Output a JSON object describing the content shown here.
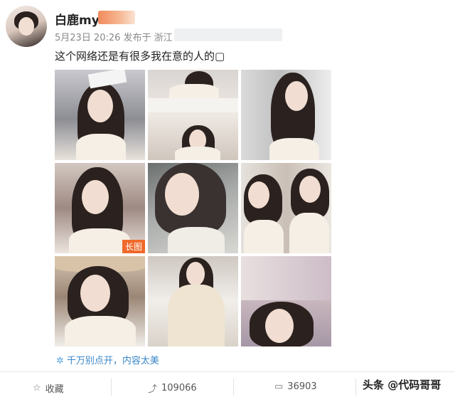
{
  "post": {
    "username": "白鹿my",
    "meta": "5月23日 20:26 发布于 浙江",
    "text": "这个网络还是有很多我在意的人的▢"
  },
  "images": [
    {
      "name": "photo-1"
    },
    {
      "name": "photo-2"
    },
    {
      "name": "photo-3"
    },
    {
      "name": "photo-4",
      "badge": "长图"
    },
    {
      "name": "photo-5"
    },
    {
      "name": "photo-6"
    },
    {
      "name": "photo-7"
    },
    {
      "name": "photo-8"
    },
    {
      "name": "photo-9"
    }
  ],
  "hint": {
    "icon": "spark-icon",
    "text": "千万别点开，内容太美"
  },
  "actions": {
    "favorite": {
      "icon": "star-icon",
      "label": "收藏"
    },
    "repost": {
      "icon": "repost-icon",
      "count": "109066"
    },
    "comment": {
      "icon": "comment-icon",
      "count": "36903"
    }
  },
  "watermark": "头条 @代码哥哥",
  "colors": {
    "accent": "#f06a2c",
    "link": "#3a86c8"
  }
}
